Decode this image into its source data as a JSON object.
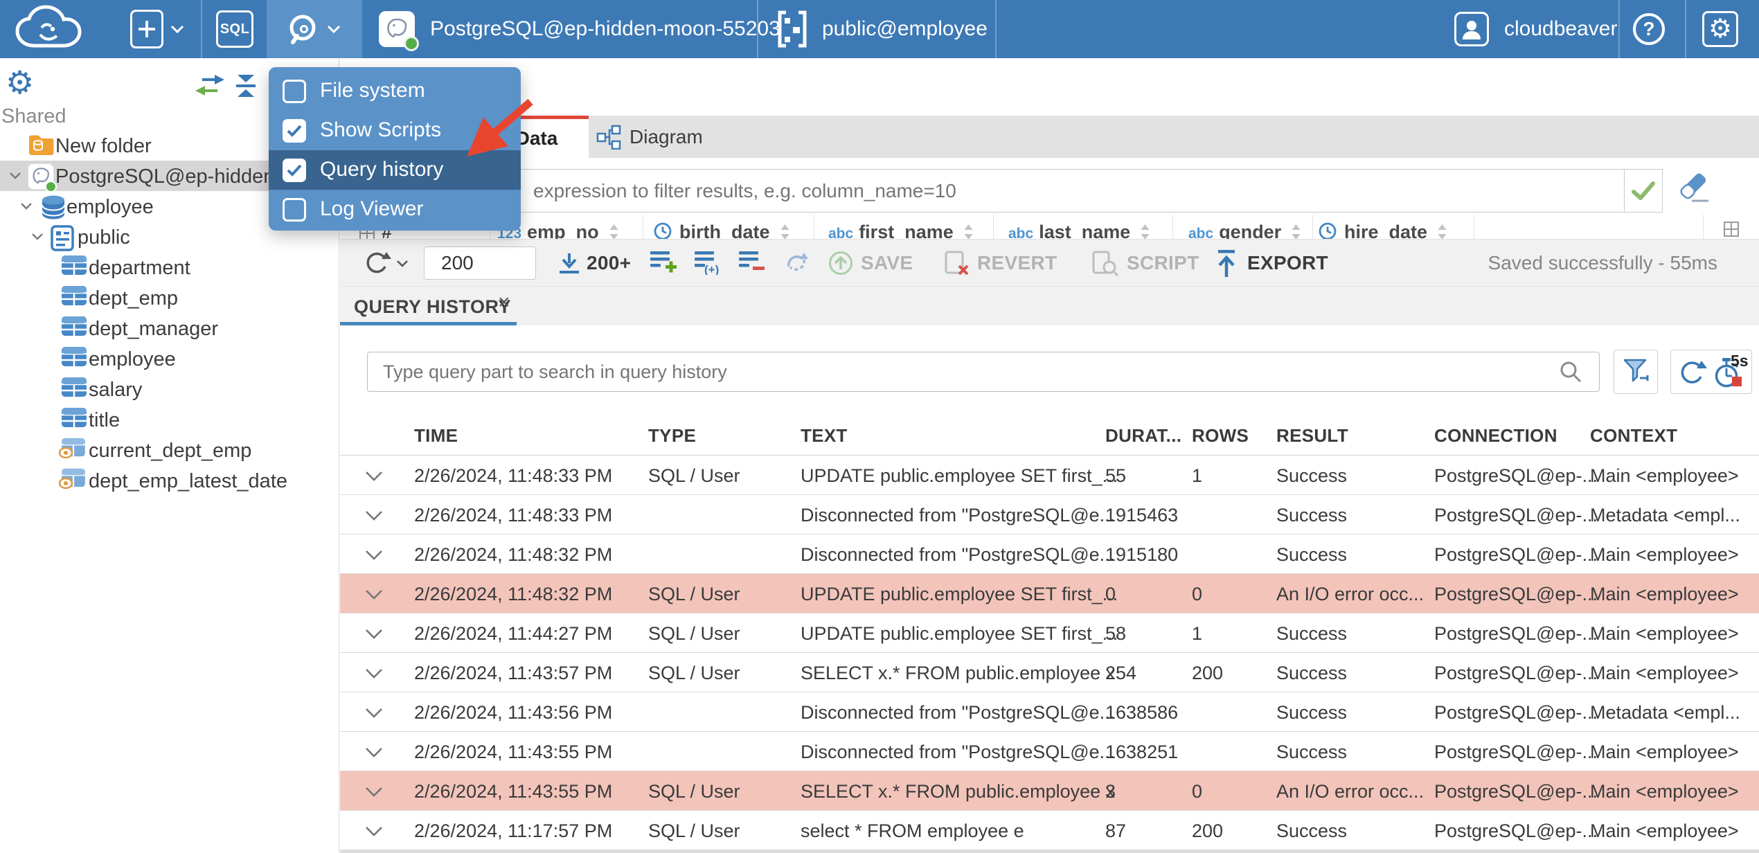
{
  "topbar": {
    "sql_label": "SQL",
    "connection_name": "PostgreSQL@ep-hidden-moon-55203",
    "schema_path": "public@employee",
    "username": "cloudbeaver",
    "help_glyph": "?",
    "accent_color": "#3d79b5"
  },
  "tools_menu": {
    "items": [
      {
        "label": "File system",
        "checked": false,
        "highlighted": false
      },
      {
        "label": "Show Scripts",
        "checked": true,
        "highlighted": false
      },
      {
        "label": "Query history",
        "checked": true,
        "highlighted": true
      },
      {
        "label": "Log Viewer",
        "checked": false,
        "highlighted": false
      }
    ]
  },
  "sidebar": {
    "section_label": "Shared",
    "tree": [
      {
        "label": "New folder",
        "icon": "folder-icon",
        "indent": 0,
        "chevron": false,
        "selected": false
      },
      {
        "label": "PostgreSQL@ep-hidden-",
        "icon": "postgres-icon",
        "indent": 0,
        "chevron": true,
        "selected": true
      },
      {
        "label": "employee",
        "icon": "database-icon",
        "indent": 1,
        "chevron": true,
        "selected": false
      },
      {
        "label": "public",
        "icon": "schema-icon",
        "indent": 2,
        "chevron": true,
        "selected": false
      },
      {
        "label": "department",
        "icon": "table-icon",
        "indent": 3,
        "chevron": false,
        "selected": false
      },
      {
        "label": "dept_emp",
        "icon": "table-icon",
        "indent": 3,
        "chevron": false,
        "selected": false
      },
      {
        "label": "dept_manager",
        "icon": "table-icon",
        "indent": 3,
        "chevron": false,
        "selected": false
      },
      {
        "label": "employee",
        "icon": "table-icon",
        "indent": 3,
        "chevron": false,
        "selected": false
      },
      {
        "label": "salary",
        "icon": "table-icon",
        "indent": 3,
        "chevron": false,
        "selected": false
      },
      {
        "label": "title",
        "icon": "table-icon",
        "indent": 3,
        "chevron": false,
        "selected": false
      },
      {
        "label": "current_dept_emp",
        "icon": "view-icon",
        "indent": 3,
        "chevron": false,
        "selected": false
      },
      {
        "label": "dept_emp_latest_date",
        "icon": "view-icon",
        "indent": 3,
        "chevron": false,
        "selected": false
      }
    ]
  },
  "editor": {
    "data_tab_label": "Data",
    "diagram_tab_label": "Diagram",
    "filter_placeholder": "expression to filter results, e.g. column_name=10",
    "grid_header_columns": [
      {
        "prefix": "",
        "icon": "grid-icon",
        "label": "#"
      },
      {
        "prefix": "123",
        "icon": "",
        "label": "emp_no"
      },
      {
        "prefix": "",
        "icon": "clock-icon",
        "label": "birth_date"
      },
      {
        "prefix": "abc",
        "icon": "",
        "label": "first_name"
      },
      {
        "prefix": "abc",
        "icon": "",
        "label": "last_name"
      },
      {
        "prefix": "abc",
        "icon": "",
        "label": "gender"
      },
      {
        "prefix": "",
        "icon": "clock-icon",
        "label": "hire_date"
      }
    ],
    "toolbar": {
      "row_limit_value": "200",
      "fetch_label": "200+",
      "save_label": "SAVE",
      "revert_label": "REVERT",
      "script_label": "SCRIPT",
      "export_label": "EXPORT",
      "status_text": "Saved successfully - 55ms"
    }
  },
  "query_history": {
    "tab_label": "QUERY HISTORY",
    "close_label": "×",
    "search_placeholder": "Type query part to search in query history",
    "auto_refresh_interval": "5s",
    "columns": [
      "TIME",
      "TYPE",
      "TEXT",
      "DURAT...",
      "ROWS",
      "RESULT",
      "CONNECTION",
      "CONTEXT"
    ],
    "error_row_color": "#f2c4ba",
    "rows": [
      {
        "time": "2/26/2024, 11:48:33 PM",
        "type": "SQL / User",
        "text": "UPDATE public.employee SET first_...",
        "duration": "55",
        "rows": "1",
        "result": "Success",
        "connection": "PostgreSQL@ep-...",
        "context": "Main <employee>",
        "error": false
      },
      {
        "time": "2/26/2024, 11:48:33 PM",
        "type": "",
        "text": "Disconnected from \"PostgreSQL@e...",
        "duration": "1915463",
        "rows": "",
        "result": "Success",
        "connection": "PostgreSQL@ep-...",
        "context": "Metadata <empl...",
        "error": false
      },
      {
        "time": "2/26/2024, 11:48:32 PM",
        "type": "",
        "text": "Disconnected from \"PostgreSQL@e...",
        "duration": "1915180",
        "rows": "",
        "result": "Success",
        "connection": "PostgreSQL@ep-...",
        "context": "Main <employee>",
        "error": false
      },
      {
        "time": "2/26/2024, 11:48:32 PM",
        "type": "SQL / User",
        "text": "UPDATE public.employee SET first_...",
        "duration": "0",
        "rows": "0",
        "result": "An I/O error occ...",
        "connection": "PostgreSQL@ep-...",
        "context": "Main <employee>",
        "error": true
      },
      {
        "time": "2/26/2024, 11:44:27 PM",
        "type": "SQL / User",
        "text": "UPDATE public.employee SET first_...",
        "duration": "58",
        "rows": "1",
        "result": "Success",
        "connection": "PostgreSQL@ep-...",
        "context": "Main <employee>",
        "error": false
      },
      {
        "time": "2/26/2024, 11:43:57 PM",
        "type": "SQL / User",
        "text": "SELECT x.* FROM public.employee x",
        "duration": "254",
        "rows": "200",
        "result": "Success",
        "connection": "PostgreSQL@ep-...",
        "context": "Main <employee>",
        "error": false
      },
      {
        "time": "2/26/2024, 11:43:56 PM",
        "type": "",
        "text": "Disconnected from \"PostgreSQL@e...",
        "duration": "1638586",
        "rows": "",
        "result": "Success",
        "connection": "PostgreSQL@ep-...",
        "context": "Metadata <empl...",
        "error": false
      },
      {
        "time": "2/26/2024, 11:43:55 PM",
        "type": "",
        "text": "Disconnected from \"PostgreSQL@e...",
        "duration": "1638251",
        "rows": "",
        "result": "Success",
        "connection": "PostgreSQL@ep-...",
        "context": "Main <employee>",
        "error": false
      },
      {
        "time": "2/26/2024, 11:43:55 PM",
        "type": "SQL / User",
        "text": "SELECT x.* FROM public.employee x",
        "duration": "3",
        "rows": "0",
        "result": "An I/O error occ...",
        "connection": "PostgreSQL@ep-...",
        "context": "Main <employee>",
        "error": true
      },
      {
        "time": "2/26/2024, 11:17:57 PM",
        "type": "SQL / User",
        "text": "select * FROM employee e",
        "duration": "87",
        "rows": "200",
        "result": "Success",
        "connection": "PostgreSQL@ep-...",
        "context": "Main <employee>",
        "error": false
      }
    ]
  }
}
